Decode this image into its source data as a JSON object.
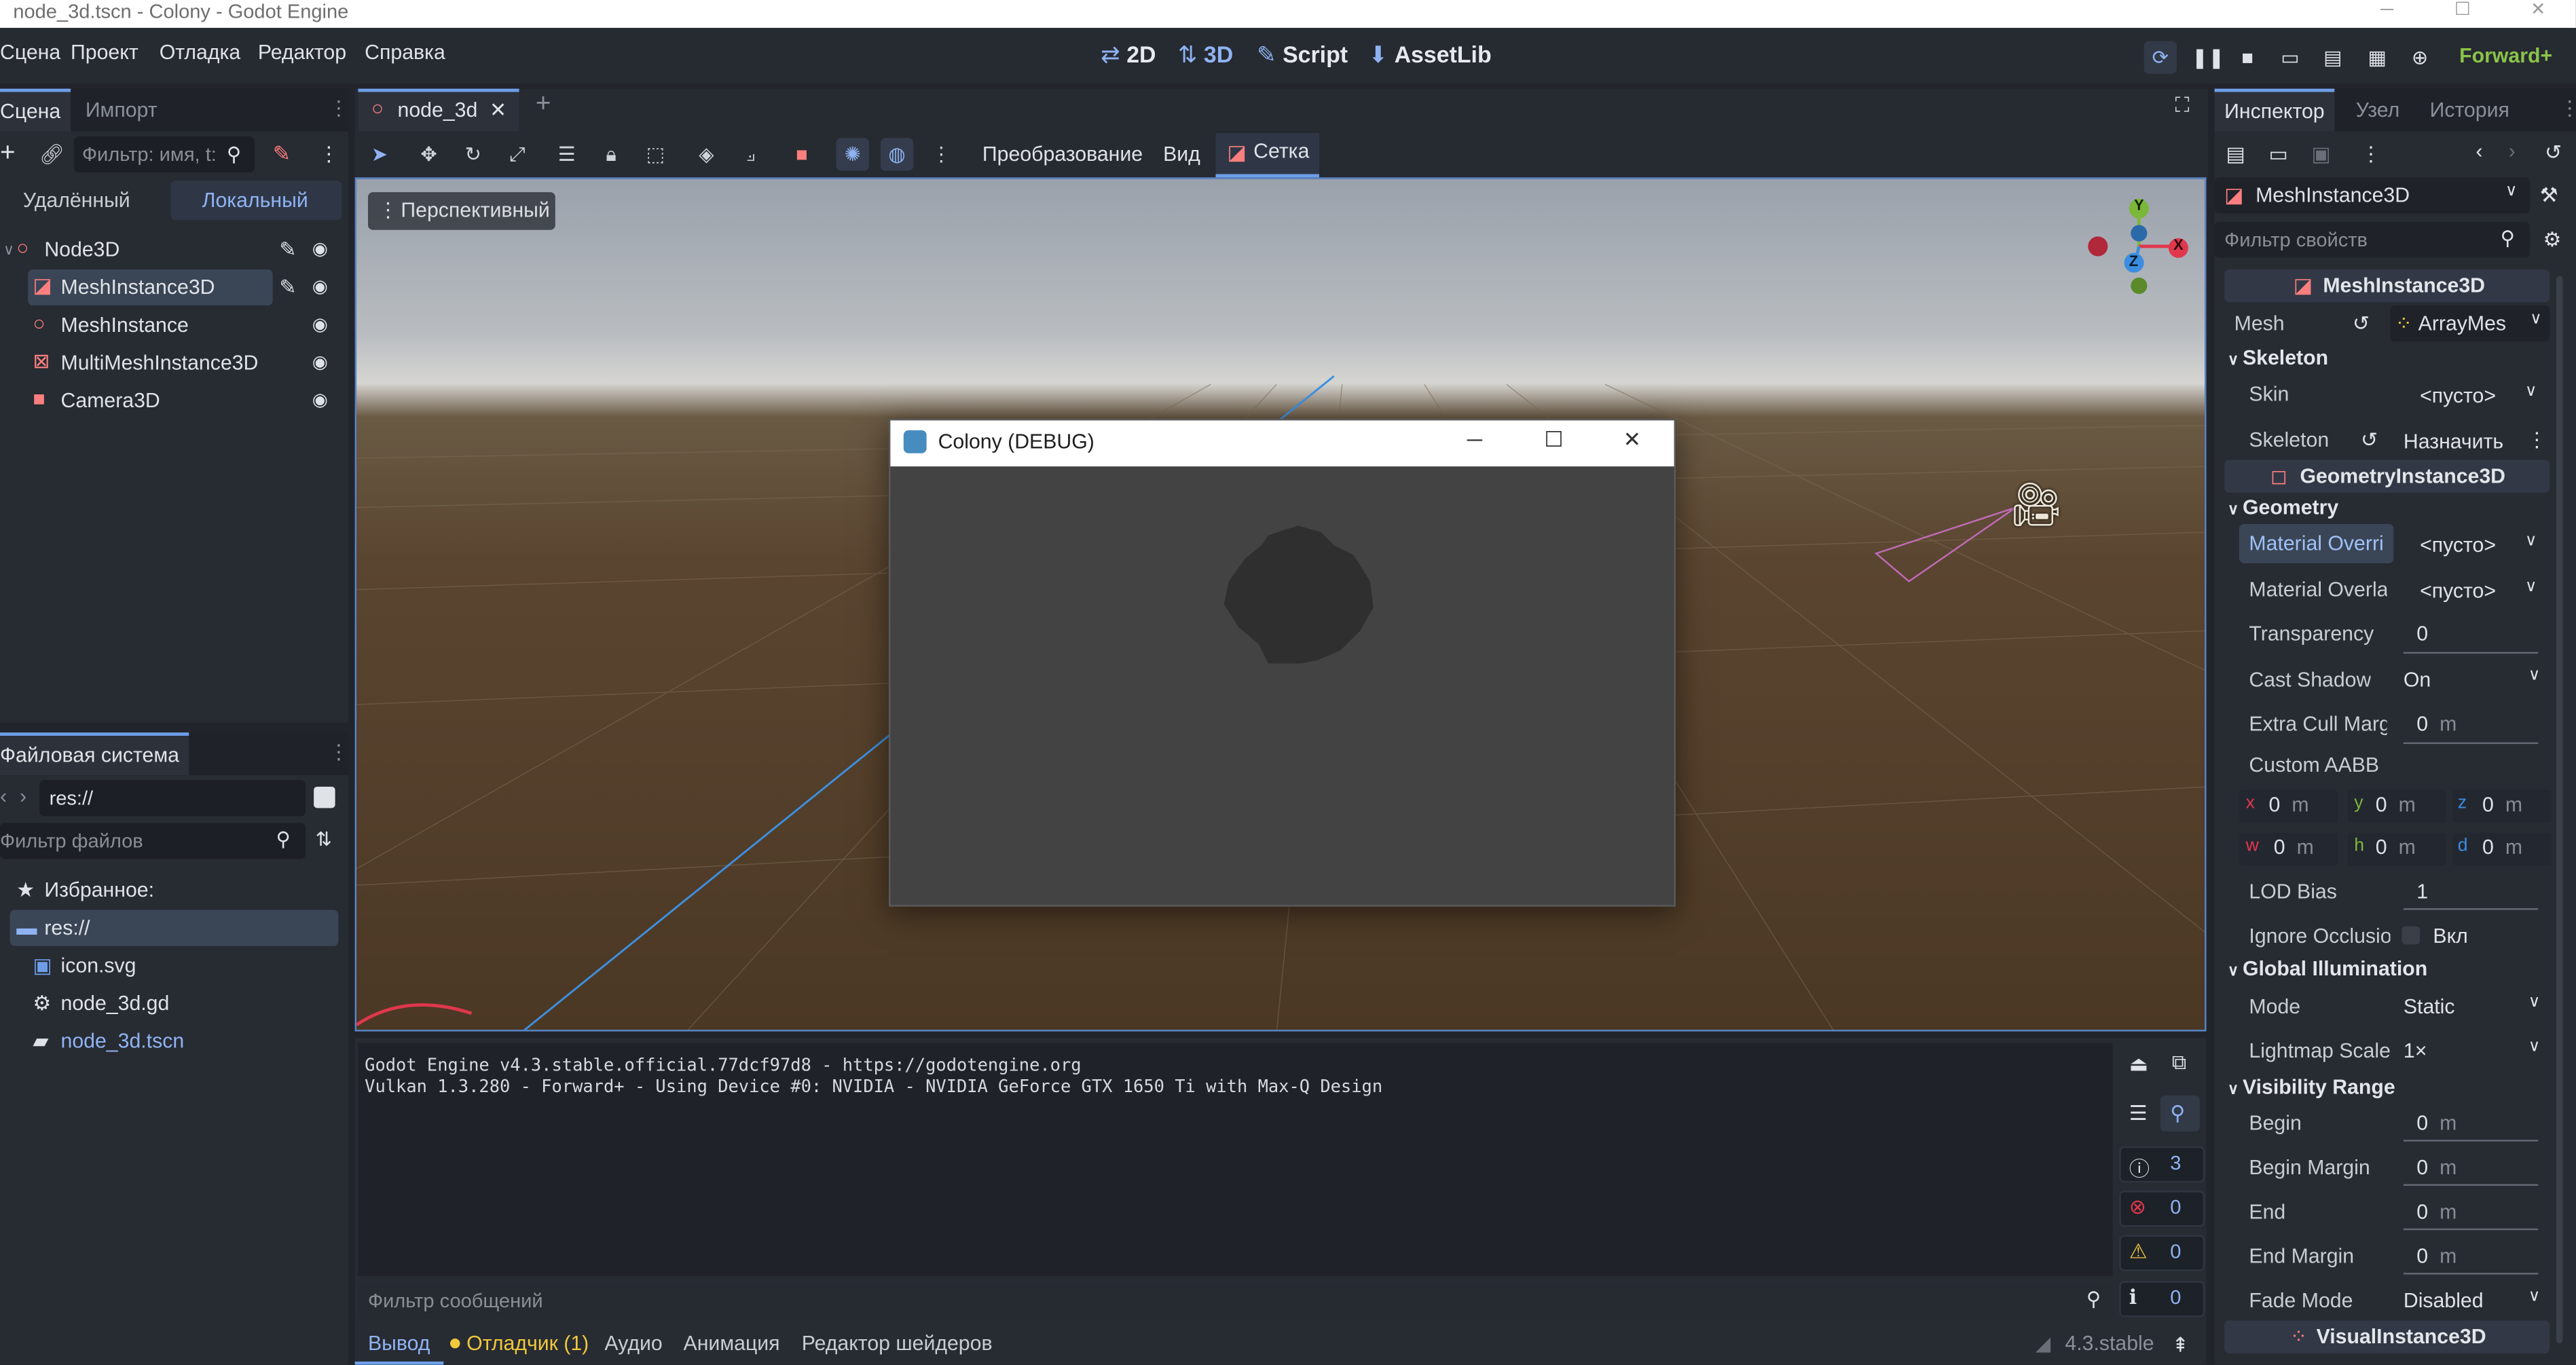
{
  "window": {
    "title": "node_3d.tscn - Colony - Godot Engine",
    "min": "─",
    "max": "☐",
    "close": "✕"
  },
  "menu": [
    "Сцена",
    "Проект",
    "Отладка",
    "Редактор",
    "Справка"
  ],
  "modes": [
    {
      "icon": "⇄",
      "label": "2D"
    },
    {
      "icon": "⇅",
      "label": "3D"
    },
    {
      "icon": "✎",
      "label": "Script"
    },
    {
      "icon": "⬇",
      "label": "AssetLib"
    }
  ],
  "renderer": "Forward+",
  "scene_panel": {
    "tabs": [
      "Сцена",
      "Импорт"
    ],
    "filter_placeholder": "Фильтр: имя, t:",
    "remote": "Удалённый",
    "local": "Локальный",
    "nodes": [
      {
        "name": "Node3D",
        "indent": 0
      },
      {
        "name": "MeshInstance3D",
        "indent": 1
      },
      {
        "name": "MeshInstance",
        "indent": 1
      },
      {
        "name": "MultiMeshInstance3D",
        "indent": 1
      },
      {
        "name": "Camera3D",
        "indent": 1
      }
    ]
  },
  "fs_panel": {
    "title": "Файловая система",
    "path": "res://",
    "filter_placeholder": "Фильтр файлов",
    "favorites": "Избранное:",
    "items": [
      {
        "name": "res://"
      },
      {
        "name": "icon.svg"
      },
      {
        "name": "node_3d.gd"
      },
      {
        "name": "node_3d.tscn"
      }
    ]
  },
  "editor": {
    "tab": "node_3d",
    "close": "✕",
    "add": "+",
    "menus": [
      "Преобразование",
      "Вид"
    ],
    "grid": "Сетка",
    "perspective": "Перспективный"
  },
  "gizmo": {
    "x": "X",
    "y": "Y",
    "z": "Z"
  },
  "debug_window": {
    "title": "Colony (DEBUG)",
    "min": "─",
    "max": "☐",
    "close": "✕"
  },
  "output": {
    "lines": [
      "Godot Engine v4.3.stable.official.77dcf97d8 - https://godotengine.org",
      "Vulkan 1.3.280 - Forward+ - Using Device #0: NVIDIA - NVIDIA GeForce GTX 1650 Ti with Max-Q Design"
    ],
    "filter_placeholder": "Фильтр сообщений",
    "counts": [
      "3",
      "0",
      "0",
      "0"
    ]
  },
  "bottom_tabs": [
    "Вывод",
    "Отладчик (1)",
    "Аудио",
    "Анимация",
    "Редактор шейдеров"
  ],
  "version": "4.3.stable",
  "inspector": {
    "tabs": [
      "Инспектор",
      "Узел",
      "История"
    ],
    "node": "MeshInstance3D",
    "filter_placeholder": "Фильтр свойств",
    "header1": "MeshInstance3D",
    "mesh_label": "Mesh",
    "mesh_value": "ArrayMes",
    "skeleton_cat": "Skeleton",
    "skin_label": "Skin",
    "skin_value": "<пусто>",
    "skeleton_label": "Skeleton",
    "skeleton_value": "Назначить",
    "header2": "GeometryInstance3D",
    "geometry_cat": "Geometry",
    "props": [
      {
        "label": "Material Overri",
        "value": "<пусто>"
      },
      {
        "label": "Material Overla",
        "value": "<пусто>"
      },
      {
        "label": "Transparency",
        "value": "0"
      },
      {
        "label": "Cast Shadow",
        "value": "On"
      },
      {
        "label": "Extra Cull Marg",
        "value": "0",
        "unit": "m"
      }
    ],
    "aabb_label": "Custom AABB",
    "aabb": [
      {
        "k": "x",
        "v": "0",
        "u": "m"
      },
      {
        "k": "y",
        "v": "0",
        "u": "m"
      },
      {
        "k": "z",
        "v": "0",
        "u": "m"
      },
      {
        "k": "w",
        "v": "0",
        "u": "m"
      },
      {
        "k": "h",
        "v": "0",
        "u": "m"
      },
      {
        "k": "d",
        "v": "0",
        "u": "m"
      }
    ],
    "lod_label": "LOD Bias",
    "lod_value": "1",
    "occl_label": "Ignore Occlusio",
    "occl_value": "Вкл",
    "gi_cat": "Global Illumination",
    "mode_label": "Mode",
    "mode_value": "Static",
    "lm_label": "Lightmap Scale",
    "lm_value": "1×",
    "vr_cat": "Visibility Range",
    "vr": [
      {
        "label": "Begin",
        "value": "0",
        "unit": "m"
      },
      {
        "label": "Begin Margin",
        "value": "0",
        "unit": "m"
      },
      {
        "label": "End",
        "value": "0",
        "unit": "m"
      },
      {
        "label": "End Margin",
        "value": "0",
        "unit": "m"
      }
    ],
    "fade_label": "Fade Mode",
    "fade_value": "Disabled",
    "header3": "VisualInstance3D"
  },
  "colors": {
    "accent": "#6e9ee8",
    "node_red": "#fc7f7f",
    "gizmo_red": "#e0374d",
    "gizmo_green": "#7bb83a",
    "gizmo_blue": "#3a8de0"
  }
}
